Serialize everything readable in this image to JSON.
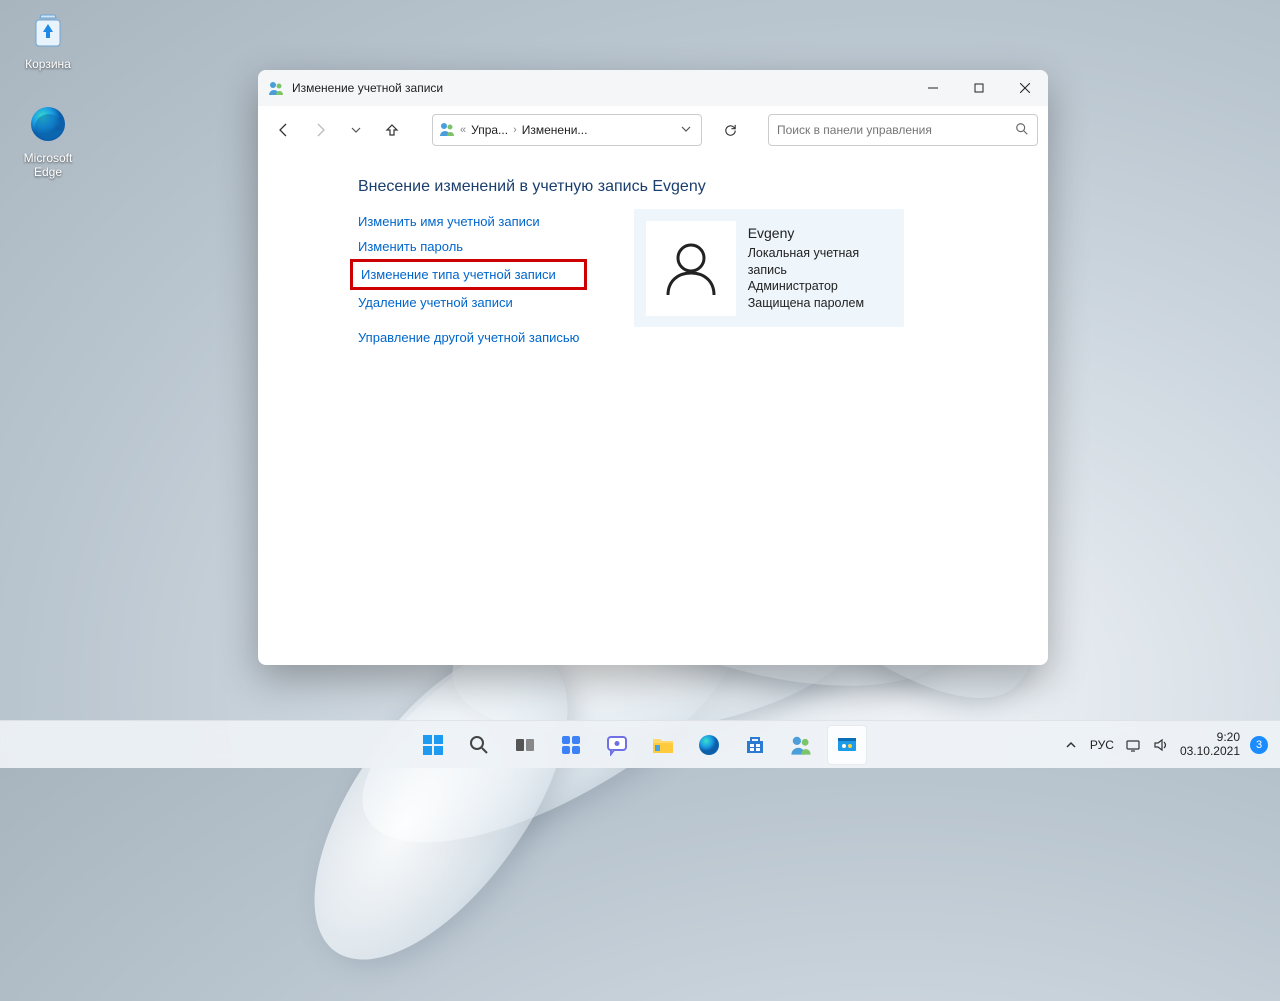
{
  "desktop": {
    "recycle_bin": "Корзина",
    "edge": "Microsoft Edge"
  },
  "window": {
    "title": "Изменение учетной записи",
    "breadcrumb": {
      "root": "Упра...",
      "current": "Изменени..."
    },
    "search_placeholder": "Поиск в панели управления",
    "page_heading": "Внесение изменений в учетную запись Evgeny",
    "links": {
      "rename": "Изменить имя учетной записи",
      "change_password": "Изменить пароль",
      "change_type": "Изменение типа учетной записи",
      "delete": "Удаление учетной записи",
      "manage_other": "Управление другой учетной записью"
    },
    "account": {
      "name": "Evgeny",
      "line1": "Локальная учетная запись",
      "line2": "Администратор",
      "line3": "Защищена паролем"
    }
  },
  "taskbar": {
    "lang": "РУС",
    "time": "9:20",
    "date": "03.10.2021",
    "badge": "3"
  }
}
